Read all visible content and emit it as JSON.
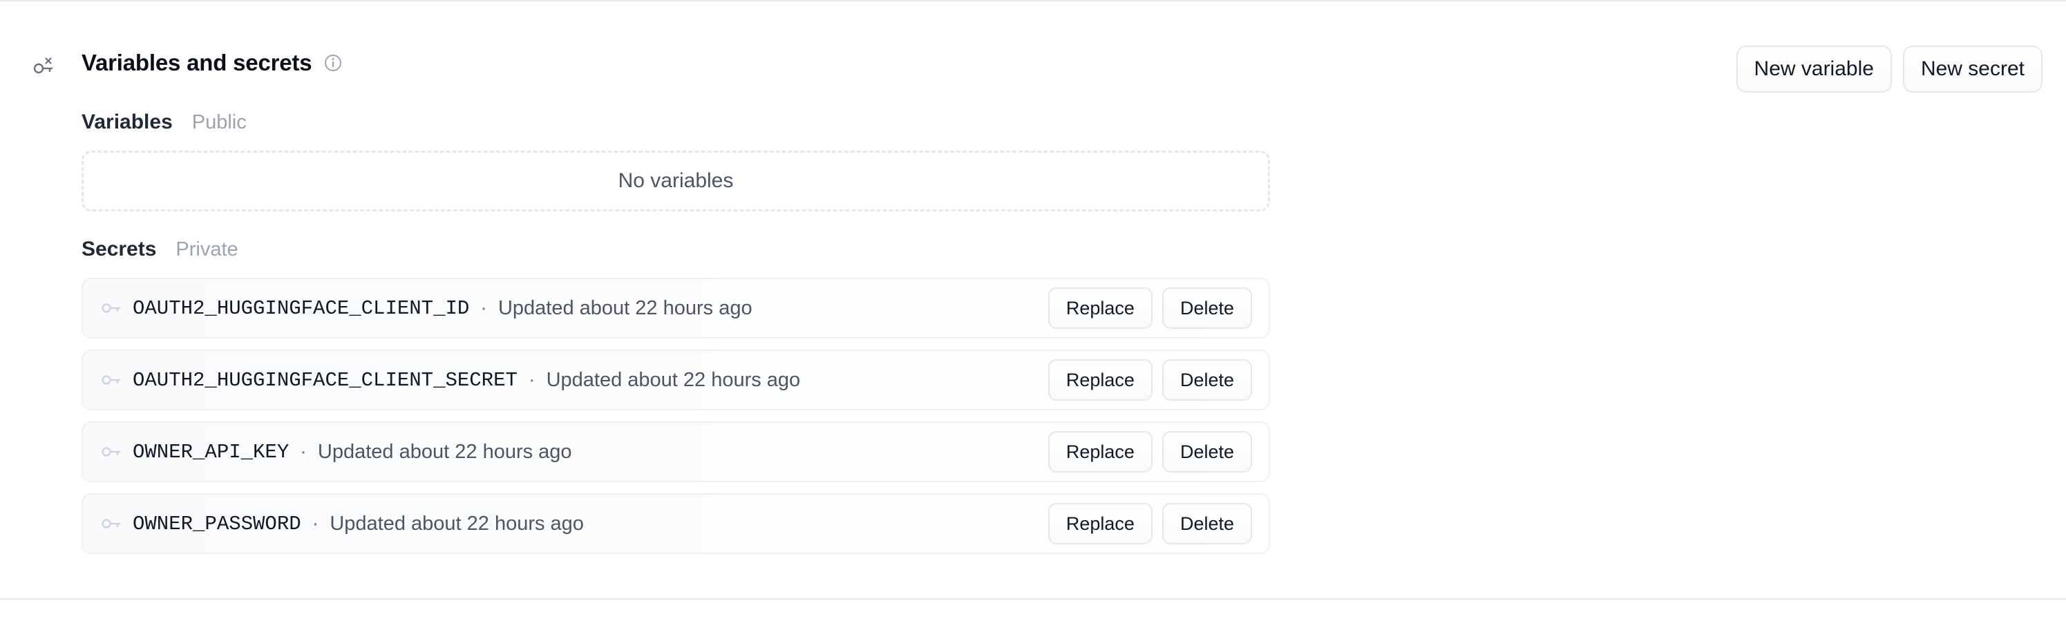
{
  "section": {
    "title": "Variables and secrets",
    "icon": "key-chain-icon",
    "info_icon": "info-icon"
  },
  "actions": {
    "new_variable": "New variable",
    "new_secret": "New secret"
  },
  "variables": {
    "heading": "Variables",
    "qualifier": "Public",
    "empty_text": "No variables"
  },
  "secrets": {
    "heading": "Secrets",
    "qualifier": "Private",
    "separator": "·",
    "replace_label": "Replace",
    "delete_label": "Delete",
    "items": [
      {
        "name": "OAUTH2_HUGGINGFACE_CLIENT_ID",
        "updated": "Updated about 22 hours ago"
      },
      {
        "name": "OAUTH2_HUGGINGFACE_CLIENT_SECRET",
        "updated": "Updated about 22 hours ago"
      },
      {
        "name": "OWNER_API_KEY",
        "updated": "Updated about 22 hours ago"
      },
      {
        "name": "OWNER_PASSWORD",
        "updated": "Updated about 22 hours ago"
      }
    ]
  },
  "colors": {
    "border": "#e5e7eb",
    "muted_text": "#9ca3af",
    "body_text": "#4b5563"
  }
}
